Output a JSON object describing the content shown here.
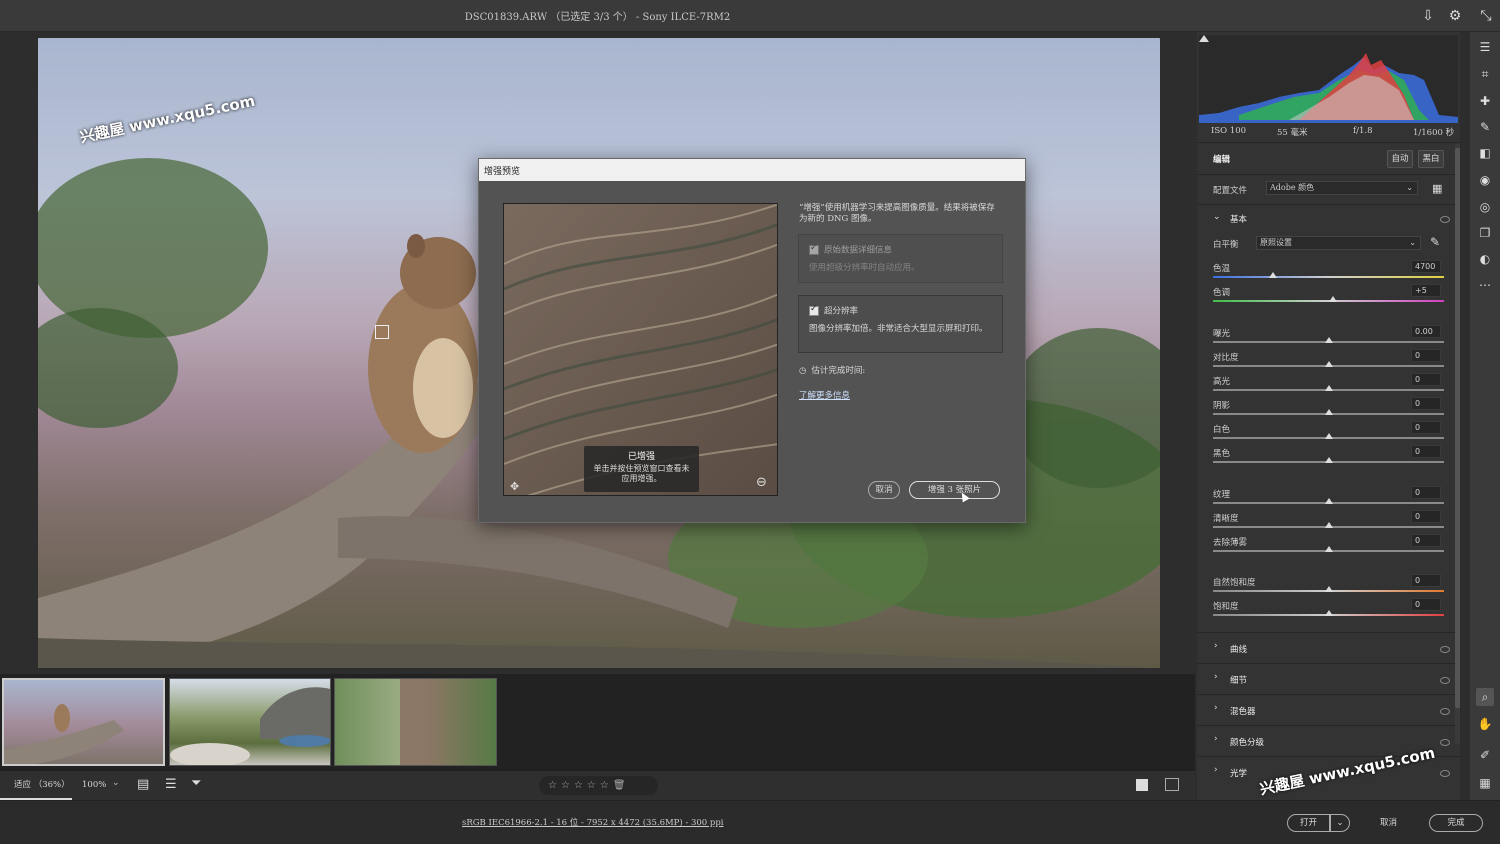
{
  "window": {
    "title": "DSC01839.ARW （已选定 3/3 个） - Sony ILCE-7RM2"
  },
  "watermark": {
    "text": "兴趣屋 www.xqu5.com"
  },
  "dialog": {
    "title": "增强预览",
    "description": "“增强”使用机器学习来提高图像质量。结果将被保存为新的 DNG 图像。",
    "option_raw": {
      "label": "原始数据详细信息",
      "desc": "使用超级分辨率时自动应用。"
    },
    "option_sr": {
      "label": "超分辨率",
      "desc": "图像分辨率加倍。非常适合大型显示屏和打印。"
    },
    "estimate_label": "估计完成时间:",
    "learn_more": "了解更多信息",
    "preview_tip_title": "已增强",
    "preview_tip_body": "单击并按住预览窗口查看未应用增强。",
    "cancel": "取消",
    "enhance": "增强 3 张照片"
  },
  "right_panel": {
    "exif": {
      "iso": "ISO 100",
      "focal": "55 毫米",
      "aperture": "f/1.8",
      "shutter": "1/1600 秒"
    },
    "edit_title": "编辑",
    "auto": "自动",
    "bw": "黑白",
    "profile_label": "配置文件",
    "profile_value": "Adobe 颜色",
    "basic_title": "基本",
    "wb_label": "白平衡",
    "wb_value": "原照设置",
    "sliders": [
      {
        "label": "色温",
        "value": "4700",
        "pos": 0.26
      },
      {
        "label": "色调",
        "value": "+5",
        "pos": 0.52
      },
      {
        "label": "曝光",
        "value": "0.00",
        "pos": 0.5
      },
      {
        "label": "对比度",
        "value": "0",
        "pos": 0.5
      },
      {
        "label": "高光",
        "value": "0",
        "pos": 0.5
      },
      {
        "label": "阴影",
        "value": "0",
        "pos": 0.5
      },
      {
        "label": "白色",
        "value": "0",
        "pos": 0.5
      },
      {
        "label": "黑色",
        "value": "0",
        "pos": 0.5
      },
      {
        "label": "纹理",
        "value": "0",
        "pos": 0.5
      },
      {
        "label": "清晰度",
        "value": "0",
        "pos": 0.5
      },
      {
        "label": "去除薄雾",
        "value": "0",
        "pos": 0.5
      },
      {
        "label": "自然饱和度",
        "value": "0",
        "pos": 0.5
      },
      {
        "label": "饱和度",
        "value": "0",
        "pos": 0.5
      }
    ],
    "sections": [
      "曲线",
      "细节",
      "混色器",
      "颜色分级",
      "光学"
    ]
  },
  "bottom_toolbar": {
    "fit": "适应 （36%）",
    "zoom": "100%"
  },
  "status": {
    "file_info": "sRGB IEC61966-2.1 - 16 位 - 7952 x 4472 (35.6MP) - 300 ppi",
    "open": "打开",
    "cancel": "取消",
    "done": "完成"
  },
  "colors": {
    "accent": "#e8e8e8",
    "panel": "#333333",
    "dialog": "#535353"
  }
}
